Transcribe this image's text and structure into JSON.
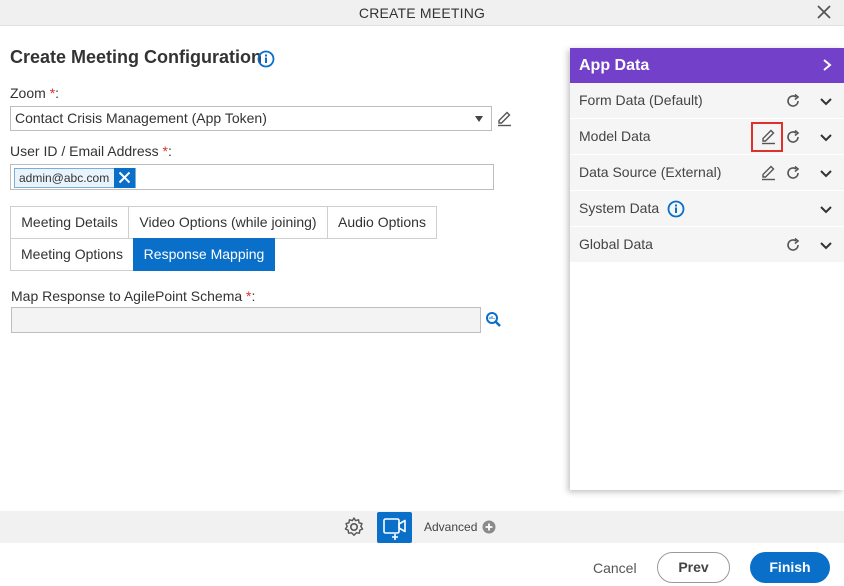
{
  "window": {
    "title": "CREATE MEETING"
  },
  "form": {
    "heading": "Create Meeting Configuration",
    "zoom_label": "Zoom",
    "zoom_value": "Contact Crisis Management (App Token)",
    "user_label": "User ID / Email Address",
    "user_chip": "admin@abc.com",
    "required_mark": "*",
    "label_colon": ":",
    "map_label": "Map Response to AgilePoint Schema"
  },
  "tabs": [
    {
      "label": "Meeting Details"
    },
    {
      "label": "Video Options (while joining)"
    },
    {
      "label": "Audio Options"
    },
    {
      "label": "Meeting Options"
    },
    {
      "label": "Response Mapping",
      "active": true
    }
  ],
  "app_data": {
    "title": "App Data",
    "rows": [
      {
        "label": "Form Data (Default)"
      },
      {
        "label": "Model Data"
      },
      {
        "label": "Data Source (External)"
      },
      {
        "label": "System Data"
      },
      {
        "label": "Global Data"
      }
    ]
  },
  "footer": {
    "advanced_label": "Advanced",
    "cancel_label": "Cancel",
    "prev_label": "Prev",
    "finish_label": "Finish"
  },
  "colors": {
    "primary": "#0a6fc9",
    "panel_header": "#7240c9",
    "required": "#d9302c",
    "highlight": "#e0302c"
  }
}
